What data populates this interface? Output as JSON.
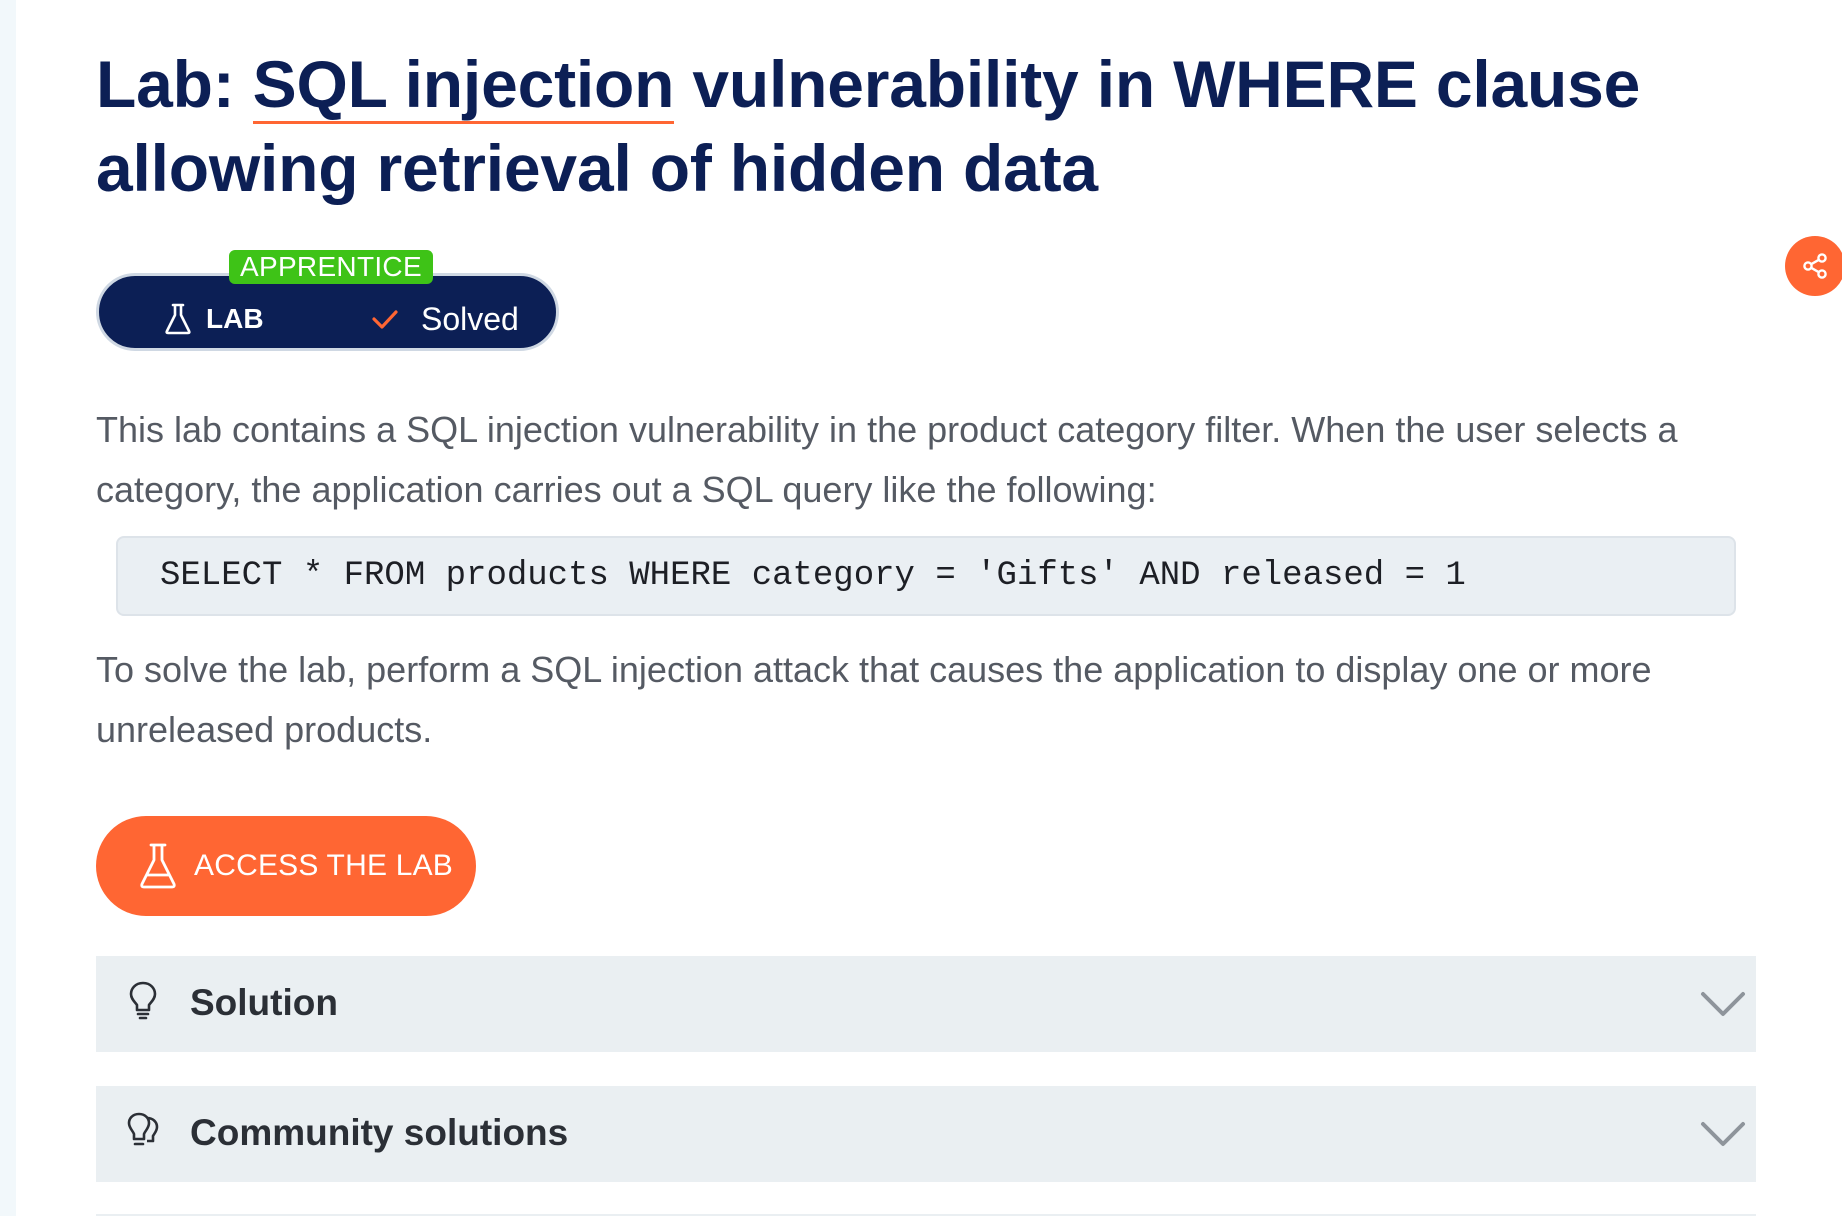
{
  "lab": {
    "title_prefix": "Lab: ",
    "title_link": "SQL injection",
    "title_rest": " vulnerability in WHERE clause allowing retrieval of hidden data",
    "level": "APPRENTICE",
    "type_label": "LAB",
    "status_label": "Solved",
    "share_icon": "share-icon"
  },
  "body": {
    "paragraph_1": "This lab contains a SQL injection vulnerability in the product category filter. When the user selects a category, the application carries out a SQL query like the following:",
    "code": "SELECT * FROM products WHERE category = 'Gifts' AND released = 1",
    "paragraph_2": "To solve the lab, perform a SQL injection attack that causes the application to display one or more unreleased products."
  },
  "actions": {
    "access_button": "ACCESS THE LAB"
  },
  "sections": [
    {
      "label": "Solution",
      "icon": "lightbulb-icon"
    },
    {
      "label": "Community solutions",
      "icon": "lightbulbs-icon"
    }
  ],
  "colors": {
    "navy": "#0c1f55",
    "accent": "#ff6633",
    "level_green": "#3ec317",
    "panel": "#eaeff2"
  }
}
